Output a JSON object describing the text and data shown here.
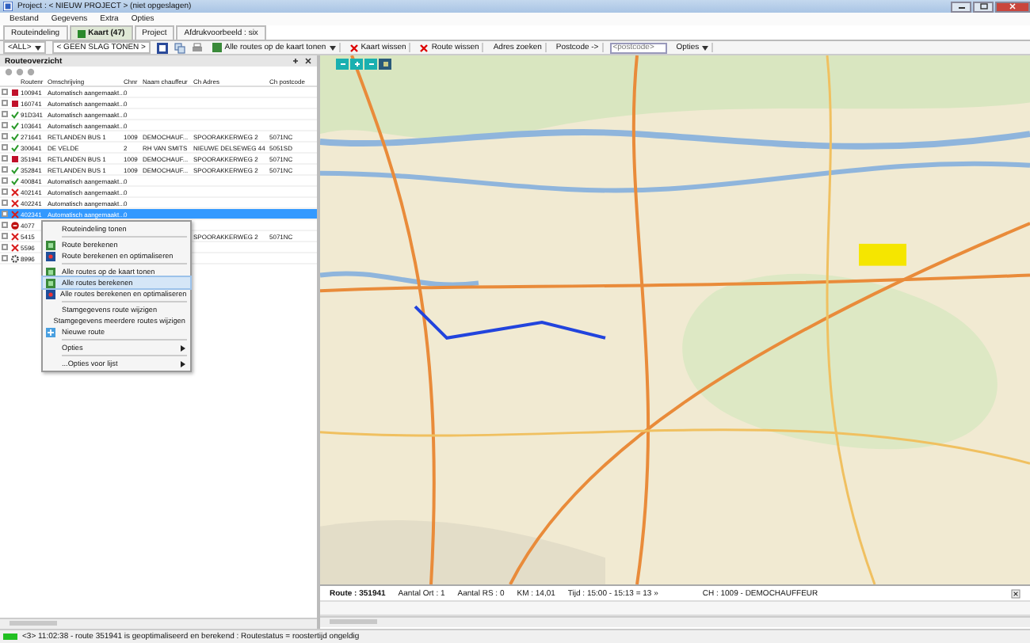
{
  "window": {
    "title": "Project : < NIEUW PROJECT > (niet opgeslagen)"
  },
  "menu": [
    "Bestand",
    "Gegevens",
    "Extra",
    "Opties"
  ],
  "tabs": [
    {
      "label": "Routeindeling",
      "selected": false
    },
    {
      "label": "Kaart (47)",
      "selected": true
    },
    {
      "label": "Project",
      "selected": false
    },
    {
      "label": "Afdrukvoorbeeld : six",
      "selected": false
    }
  ],
  "toolbar": {
    "filter": "<ALL>",
    "slag": "< GEEN SLAG TONEN >",
    "show_all": "Alle routes op de kaart tonen",
    "clear_map": "Kaart wissen",
    "clear_route": "Route wissen",
    "address": "Adres zoeken",
    "postcode_label": "Postcode ->",
    "postcode_placeholder": "<postcode>",
    "options": "Opties"
  },
  "panel": {
    "title": "Routeoverzicht"
  },
  "table": {
    "columns": [
      "Routenr",
      "Omschrijving",
      "Chnr",
      "Naam chauffeur",
      "Ch Adres",
      "Ch postcode"
    ],
    "rows": [
      {
        "kind": "dot",
        "cells": [
          "100941",
          "Automatisch aangemaakt...",
          "0",
          "",
          "",
          ""
        ],
        "selected": false
      },
      {
        "kind": "dot",
        "cells": [
          "160741",
          "Automatisch aangemaakt...",
          "0",
          "",
          "",
          ""
        ],
        "selected": false
      },
      {
        "kind": "check",
        "cells": [
          "91D341",
          "Automatisch aangemaakt...",
          "0",
          "",
          "",
          ""
        ],
        "selected": false
      },
      {
        "kind": "check",
        "cells": [
          "103641",
          "Automatisch aangemaakt...",
          "0",
          "",
          "",
          ""
        ],
        "selected": false
      },
      {
        "kind": "check",
        "cells": [
          "271641",
          "RETLANDEN BUS 1",
          "1009",
          "DEMOCHAUF...",
          "SPOORAKKERWEG 2",
          "5071NC"
        ],
        "selected": false
      },
      {
        "kind": "check",
        "cells": [
          "300641",
          "DE VELDE",
          "2",
          "RH VAN SMITS",
          "NIEUWE DELSEWEG 44",
          "5051SD"
        ],
        "selected": false
      },
      {
        "kind": "dot",
        "cells": [
          "351941",
          "RETLANDEN BUS 1",
          "1009",
          "DEMOCHAUF...",
          "SPOORAKKERWEG 2",
          "5071NC"
        ],
        "selected": false
      },
      {
        "kind": "check",
        "cells": [
          "352841",
          "RETLANDEN BUS 1",
          "1009",
          "DEMOCHAUF...",
          "SPOORAKKERWEG 2",
          "5071NC"
        ],
        "selected": false
      },
      {
        "kind": "check",
        "cells": [
          "400841",
          "Automatisch aangemaakt...",
          "0",
          "",
          "",
          ""
        ],
        "selected": false
      },
      {
        "kind": "cross",
        "cells": [
          "402141",
          "Automatisch aangemaakt...",
          "0",
          "",
          "",
          ""
        ],
        "selected": false
      },
      {
        "kind": "cross",
        "cells": [
          "402241",
          "Automatisch aangemaakt...",
          "0",
          "",
          "",
          ""
        ],
        "selected": false
      },
      {
        "kind": "cross",
        "cells": [
          "402341",
          "Automatisch aangemaakt...",
          "0",
          "",
          "",
          ""
        ],
        "selected": true
      },
      {
        "kind": "stop",
        "cells": [
          "4077",
          "",
          "",
          "",
          "",
          ""
        ],
        "selected": false
      },
      {
        "kind": "cross",
        "cells": [
          "5415",
          "",
          "",
          "",
          "SPOORAKKERWEG 2",
          "5071NC"
        ],
        "selected": false
      },
      {
        "kind": "cross",
        "cells": [
          "5596",
          "",
          "",
          "",
          "",
          ""
        ],
        "selected": false
      },
      {
        "kind": "gear",
        "cells": [
          "8996",
          "",
          "",
          "",
          "",
          ""
        ],
        "selected": false
      }
    ]
  },
  "context_menu": [
    {
      "kind": "item",
      "label": "Routeindeling tonen",
      "selected": false
    },
    {
      "kind": "separator"
    },
    {
      "kind": "item",
      "label": "Route berekenen",
      "selected": false
    },
    {
      "kind": "item",
      "label": "Route berekenen en optimaliseren",
      "selected": false
    },
    {
      "kind": "separator"
    },
    {
      "kind": "item",
      "label": "Alle routes op de kaart tonen",
      "selected": false
    },
    {
      "kind": "item",
      "label": "Alle routes berekenen",
      "selected": true
    },
    {
      "kind": "item",
      "label": "Alle routes berekenen en optimaliseren",
      "selected": false
    },
    {
      "kind": "separator"
    },
    {
      "kind": "item",
      "label": "Stamgegevens route wijzigen",
      "selected": false
    },
    {
      "kind": "item",
      "label": "Stamgegevens meerdere routes wijzigen",
      "selected": false
    },
    {
      "kind": "item",
      "label": "Nieuwe route",
      "selected": false
    },
    {
      "kind": "separator"
    },
    {
      "kind": "submenu",
      "label": "Opties",
      "selected": false
    },
    {
      "kind": "separator"
    },
    {
      "kind": "submenu",
      "label": "...Opties voor lijst",
      "selected": false
    }
  ],
  "route_info": [
    "Route : 351941",
    "Aantal Ort : 1",
    "Aantal RS : 0",
    "KM : 14,01",
    "Tijd : 15:00 - 15:13 = 13 »",
    "CH : 1009 - DEMOCHAUFFEUR"
  ],
  "status_bar": {
    "text": "<3> 11:02:38 - route 351941 is geoptimaliseerd en berekend : Routestatus = roostertijd ongeldig"
  }
}
